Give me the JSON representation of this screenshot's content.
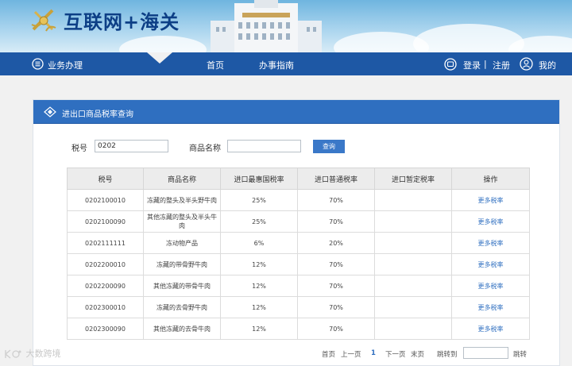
{
  "header": {
    "site_title": "互联网+海关"
  },
  "nav": {
    "left_label": "业务办理",
    "items": [
      "首页",
      "办事指南"
    ],
    "login": "登录",
    "separator": "|",
    "register": "注册",
    "mine": "我的"
  },
  "panel": {
    "title": "进出口商品税率查询",
    "search": {
      "code_label": "税号",
      "code_value": "0202",
      "name_label": "商品名称",
      "name_value": "",
      "query_button": "查询"
    },
    "table": {
      "headers": [
        "税号",
        "商品名称",
        "进口最惠国税率",
        "进口普通税率",
        "进口暂定税率",
        "操作"
      ],
      "rows": [
        {
          "code": "0202100010",
          "name": "冻藏的整头及半头野牛肉",
          "mfn": "25%",
          "general": "70%",
          "provisional": "",
          "action": "更多税率"
        },
        {
          "code": "0202100090",
          "name": "其他冻藏的整头及半头牛肉",
          "mfn": "25%",
          "general": "70%",
          "provisional": "",
          "action": "更多税率"
        },
        {
          "code": "0202111111",
          "name": "冻动物产品",
          "mfn": "6%",
          "general": "20%",
          "provisional": "",
          "action": "更多税率"
        },
        {
          "code": "0202200010",
          "name": "冻藏的带骨野牛肉",
          "mfn": "12%",
          "general": "70%",
          "provisional": "",
          "action": "更多税率"
        },
        {
          "code": "0202200090",
          "name": "其他冻藏的带骨牛肉",
          "mfn": "12%",
          "general": "70%",
          "provisional": "",
          "action": "更多税率"
        },
        {
          "code": "0202300010",
          "name": "冻藏的去骨野牛肉",
          "mfn": "12%",
          "general": "70%",
          "provisional": "",
          "action": "更多税率"
        },
        {
          "code": "0202300090",
          "name": "其他冻藏的去骨牛肉",
          "mfn": "12%",
          "general": "70%",
          "provisional": "",
          "action": "更多税率"
        }
      ]
    },
    "pager": {
      "first": "首页",
      "prev": "上一页",
      "current": "1",
      "next": "下一页",
      "last": "末页",
      "jump_label": "跳转到",
      "jump_button": "跳转"
    }
  },
  "watermark": "大数跨境",
  "colors": {
    "nav": "#1e58a5",
    "panel_header": "#2f6fc0",
    "link": "#2f6fc0"
  }
}
